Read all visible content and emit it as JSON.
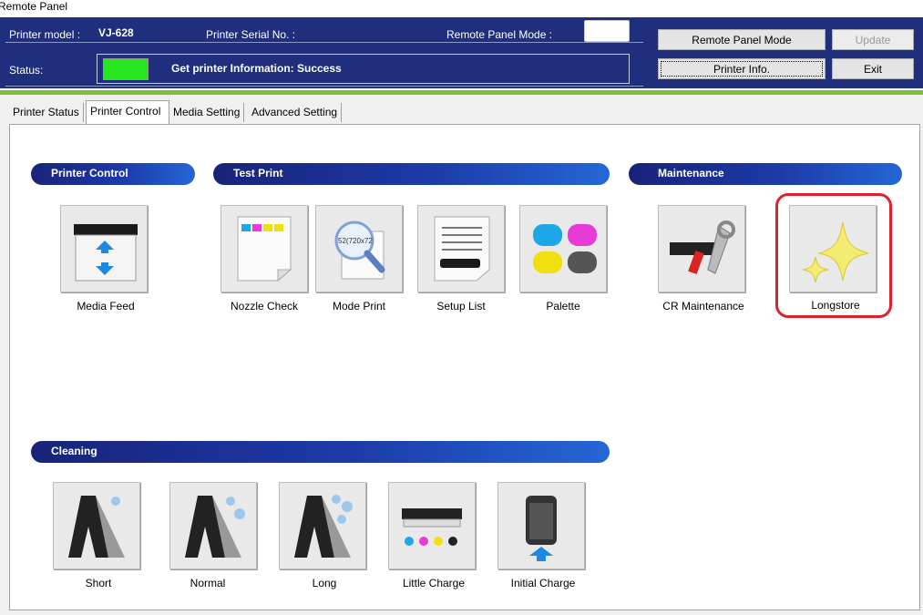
{
  "window": {
    "title": "Remote Panel"
  },
  "header": {
    "printer_model_label": "Printer model :",
    "printer_model_value": "VJ-628",
    "serial_label": "Printer Serial No. :",
    "mode_label": "Remote Panel Mode :",
    "status_label": "Status:",
    "status_message": "Get printer Information: Success",
    "status_color": "#26e61f"
  },
  "buttons": {
    "remote_panel_mode": "Remote Panel Mode",
    "update": "Update",
    "printer_info": "Printer Info.",
    "exit": "Exit"
  },
  "tabs": [
    "Printer Status",
    "Printer Control",
    "Media Setting",
    "Advanced Setting"
  ],
  "active_tab": "Printer Control",
  "sections": {
    "printer_control": {
      "title": "Printer Control",
      "items": [
        {
          "label": "Media Feed",
          "icon": "media-feed-icon"
        }
      ]
    },
    "test_print": {
      "title": "Test Print",
      "items": [
        {
          "label": "Nozzle Check",
          "icon": "nozzle-check-icon"
        },
        {
          "label": "Mode Print",
          "icon": "mode-print-icon",
          "icon_text": "52(720x72"
        },
        {
          "label": "Setup List",
          "icon": "setup-list-icon"
        },
        {
          "label": "Palette",
          "icon": "palette-icon"
        }
      ]
    },
    "maintenance": {
      "title": "Maintenance",
      "items": [
        {
          "label": "CR Maintenance",
          "icon": "cr-maintenance-icon"
        },
        {
          "label": "Longstore",
          "icon": "longstore-icon",
          "highlighted": true
        }
      ]
    },
    "cleaning": {
      "title": "Cleaning",
      "items": [
        {
          "label": "Short",
          "icon": "cleaning-short-icon"
        },
        {
          "label": "Normal",
          "icon": "cleaning-normal-icon"
        },
        {
          "label": "Long",
          "icon": "cleaning-long-icon"
        },
        {
          "label": "Little Charge",
          "icon": "little-charge-icon"
        },
        {
          "label": "Initial Charge",
          "icon": "initial-charge-icon"
        }
      ]
    }
  },
  "colors": {
    "header_bg": "#1f2e7d",
    "accent_green": "#7dbf3a",
    "highlight_red": "#e0202a",
    "cyan": "#1ea7e8",
    "magenta": "#e83ad6",
    "yellow": "#f0e010",
    "black": "#555555"
  }
}
